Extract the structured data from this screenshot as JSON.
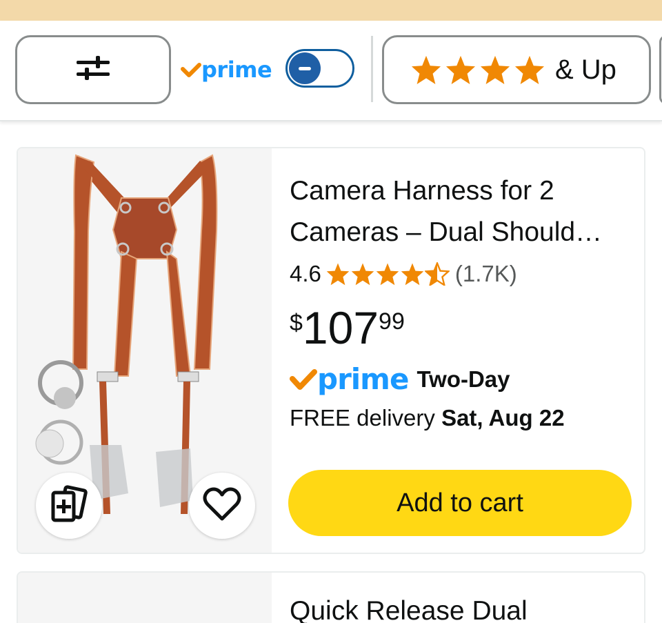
{
  "colors": {
    "top_strip": "#f3d9a9",
    "prime_blue": "#1a98ff",
    "prime_check": "#f08804",
    "star_orange": "#f08804",
    "cart_yellow": "#ffd814",
    "toggle_blue": "#1f5fa6"
  },
  "filters": {
    "filter_icon": "sliders-icon",
    "prime_label": "prime",
    "prime_toggle_on": false,
    "stars_rating": 4,
    "stars_label": "& Up"
  },
  "product": {
    "title_line1": "Camera Harness for 2",
    "title_line2": "Cameras – Dual Should…",
    "rating": "4.6",
    "rating_stars": 4.5,
    "review_count": "(1.7K)",
    "price_symbol": "$",
    "price_whole": "107",
    "price_fraction": "99",
    "prime_label": "prime",
    "shipping_speed": "Two-Day",
    "delivery_prefix": "FREE delivery",
    "delivery_date": "Sat, Aug 22",
    "add_to_cart": "Add to cart",
    "compare_icon": "compare-icon",
    "wishlist_icon": "heart-icon"
  },
  "next_product": {
    "title": "Quick Release Dual"
  }
}
